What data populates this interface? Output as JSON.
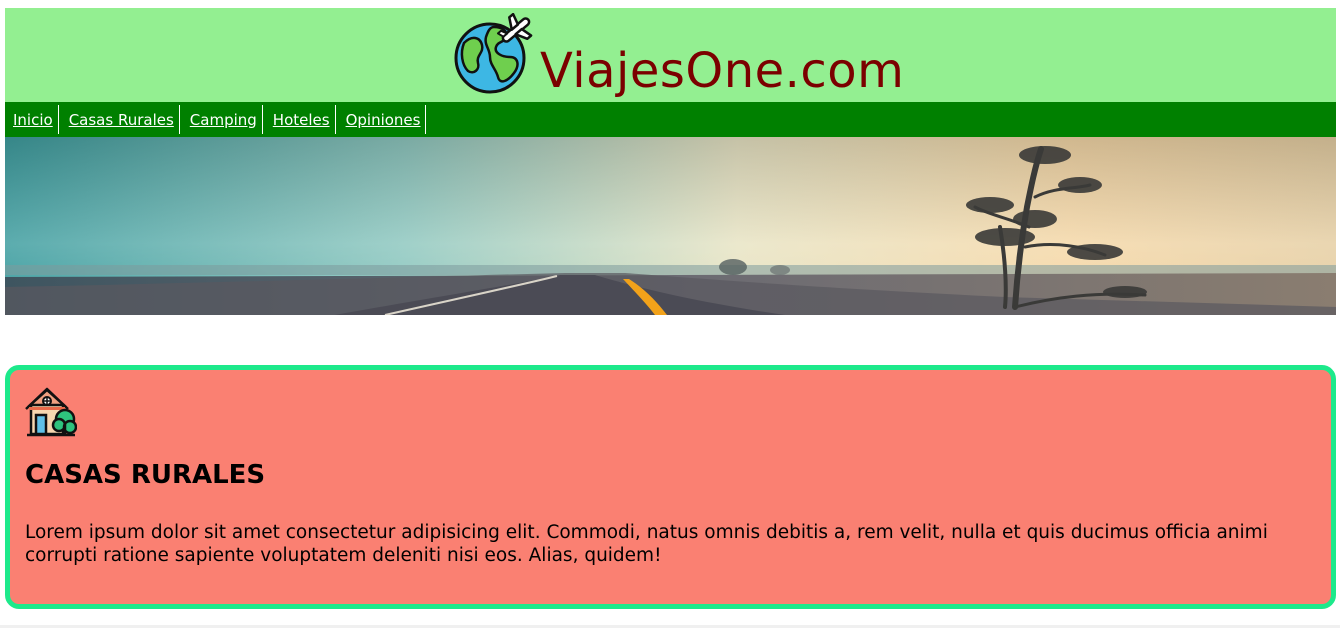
{
  "site": {
    "name": "ViajesOne.com",
    "logo_icon": "globe-airplane-icon",
    "brand_color": "#7b0000",
    "header_bg": "#93ef91"
  },
  "nav": {
    "bg": "#008000",
    "items": [
      {
        "label": "Inicio"
      },
      {
        "label": "Casas Rurales"
      },
      {
        "label": "Camping"
      },
      {
        "label": "Hoteles"
      },
      {
        "label": "Opiniones"
      }
    ]
  },
  "hero": {
    "image": "foggy-road-landscape"
  },
  "card": {
    "icon": "rural-house-icon",
    "title": "CASAS RURALES",
    "text": "Lorem ipsum dolor sit amet consectetur adipisicing elit. Commodi, natus omnis debitis a, rem velit, nulla et quis ducimus officia animi corrupti ratione sapiente voluptatem deleniti nisi eos. Alias, quidem!",
    "bg": "#fa8072",
    "border": "#1de98b"
  }
}
